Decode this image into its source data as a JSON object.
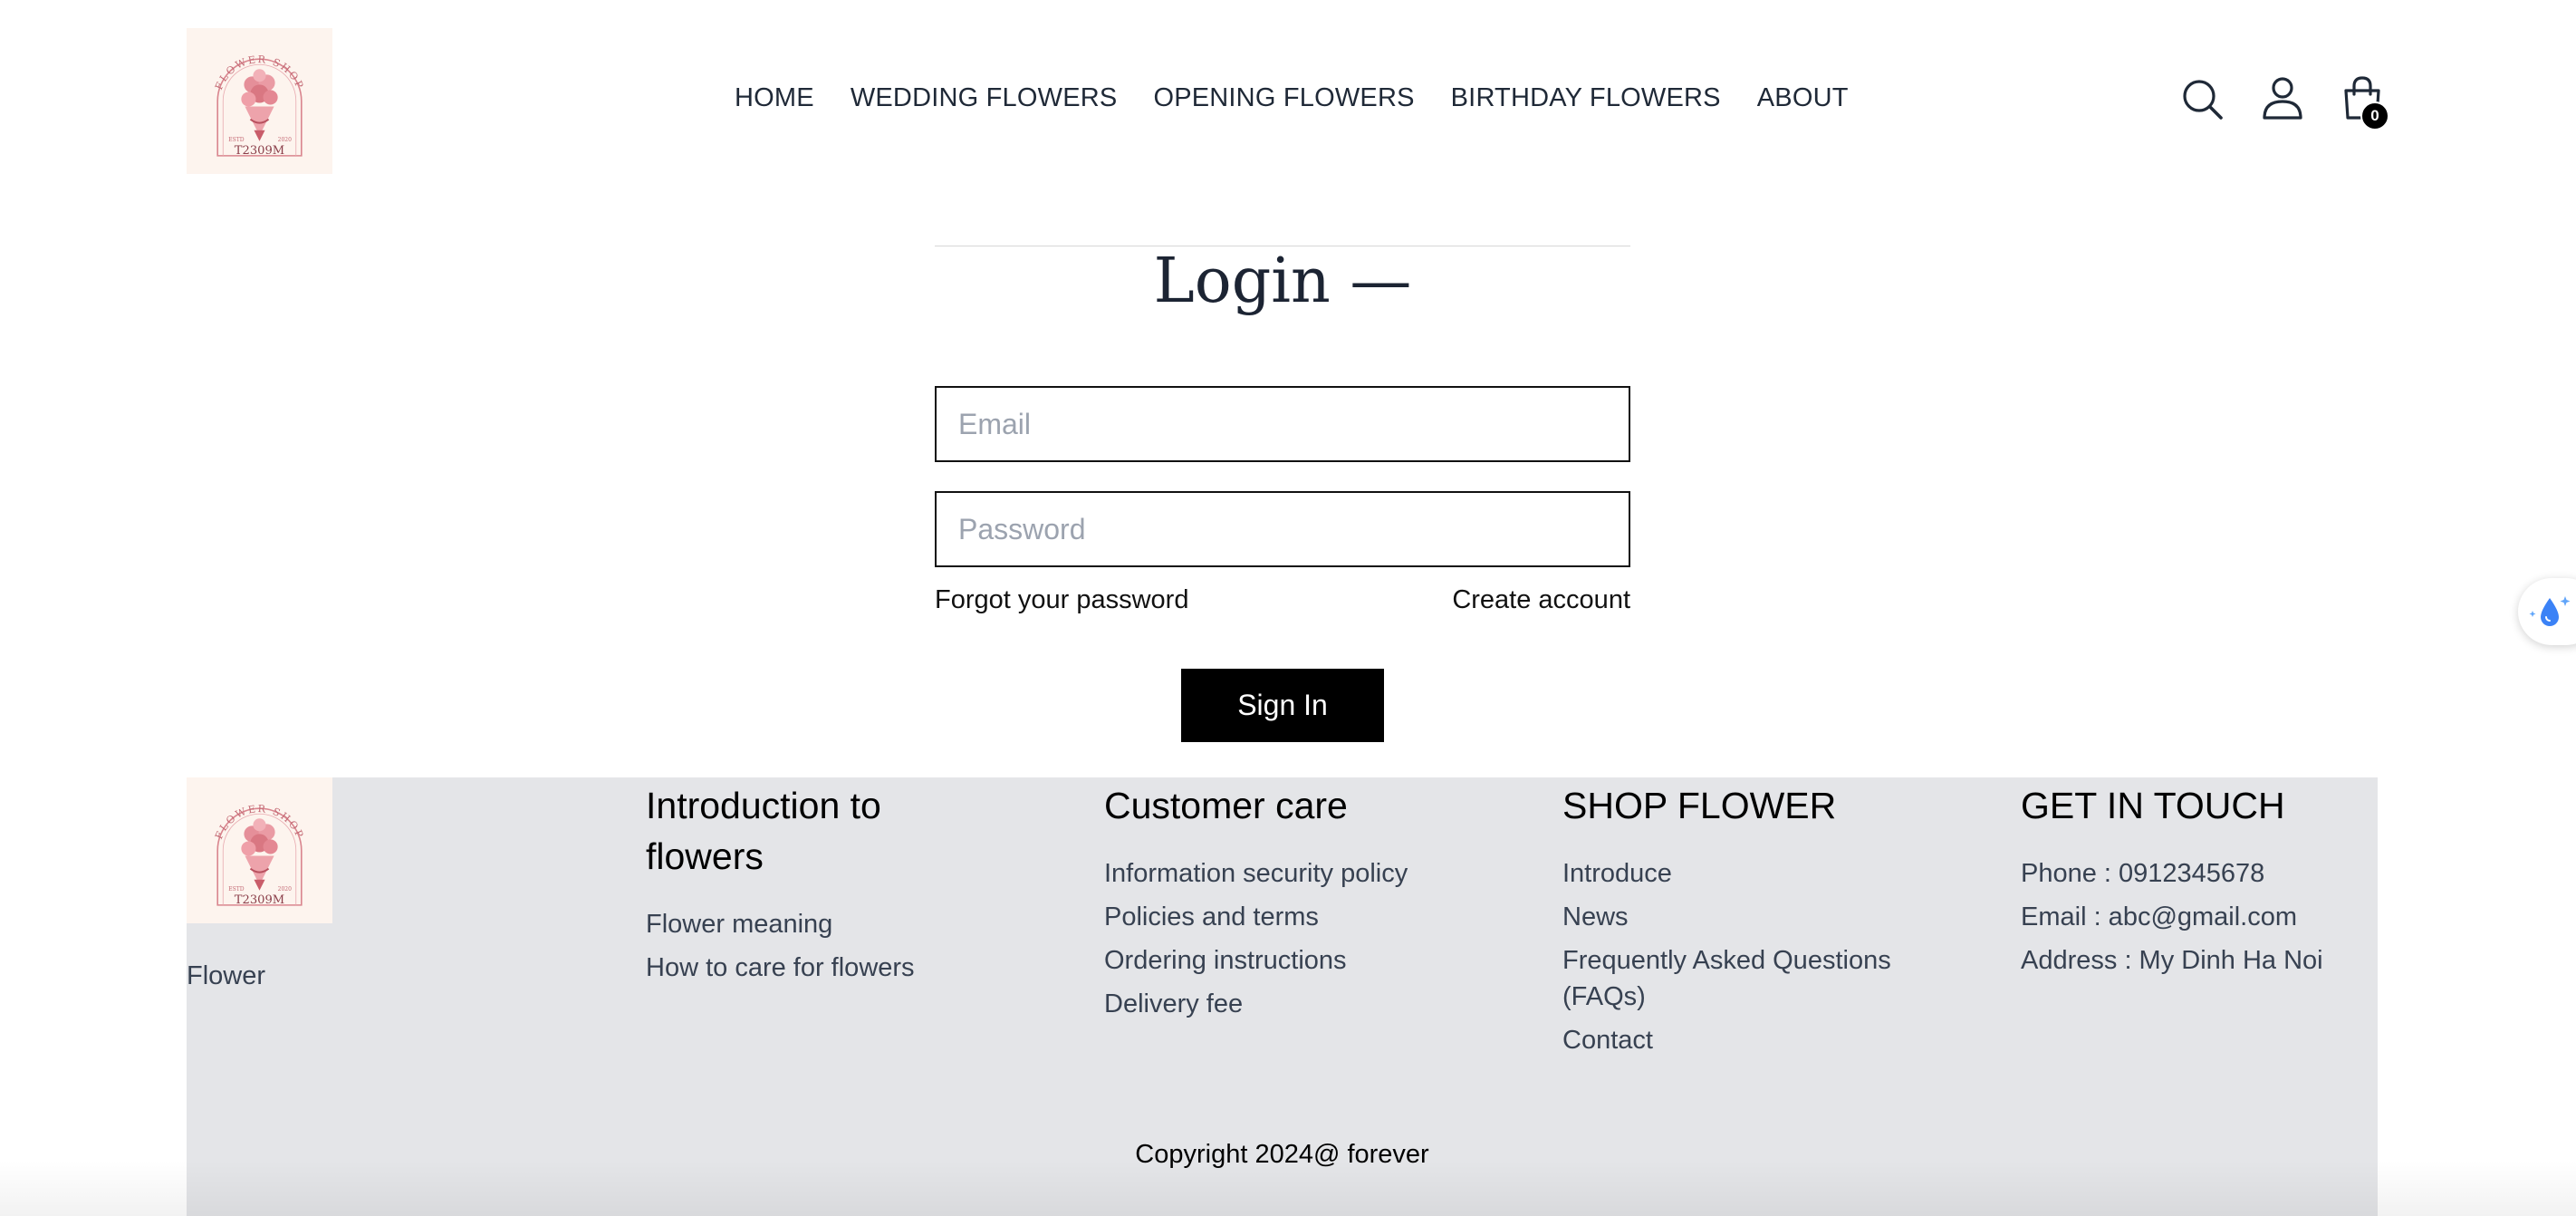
{
  "header": {
    "logo": {
      "arc_text": "FLOWER SHOP",
      "brand": "T2309M",
      "est_left": "ESTD",
      "est_right": "2020"
    },
    "nav": [
      {
        "label": "HOME"
      },
      {
        "label": "WEDDING FLOWERS"
      },
      {
        "label": "OPENING FLOWERS"
      },
      {
        "label": "BIRTHDAY FLOWERS"
      },
      {
        "label": "ABOUT"
      }
    ],
    "icons": [
      "search-icon",
      "user-icon",
      "shopping-bag-icon"
    ],
    "cart_count": "0"
  },
  "login": {
    "title": "Login —",
    "email_placeholder": "Email",
    "password_placeholder": "Password",
    "forgot_password": "Forgot your password",
    "create_account": "Create account",
    "sign_in": "Sign In"
  },
  "floating_widget": {
    "icon": "water-drop-sparkle-icon",
    "color": "#3b82f6"
  },
  "footer": {
    "brand_text": "Flower",
    "columns": [
      {
        "title": "Introduction to flowers",
        "items": [
          "Flower meaning",
          "How to care for flowers"
        ]
      },
      {
        "title": "Customer care",
        "items": [
          "Information security policy",
          "Policies and terms",
          "Ordering instructions",
          "Delivery fee"
        ]
      },
      {
        "title": "SHOP FLOWER",
        "items": [
          "Introduce",
          "News",
          "Frequently Asked Questions (FAQs)",
          "Contact"
        ]
      },
      {
        "title": "GET IN TOUCH",
        "items": [
          "Phone : 0912345678",
          "Email : abc@gmail.com",
          "Address : My Dinh Ha Noi"
        ]
      }
    ],
    "copyright": "Copyright 2024@ forever"
  },
  "colors": {
    "footer_bg": "#e4e5e8",
    "button_bg": "#000000",
    "logo_bg": "#fdf4ee",
    "logo_accent": "#d9858e",
    "nav_text": "#1f2937"
  }
}
